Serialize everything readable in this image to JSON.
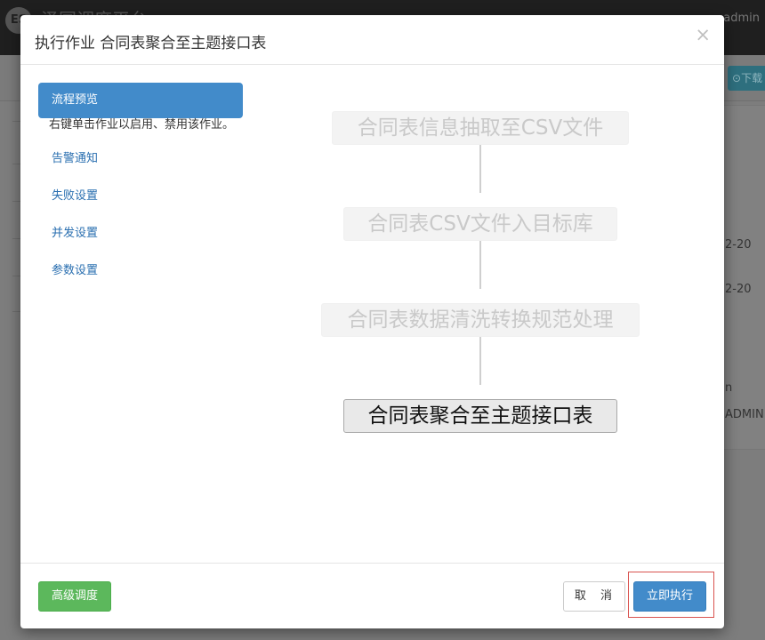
{
  "background": {
    "brand_initials": "ES",
    "brand": "泽国调度平台",
    "user": "admin",
    "page_title_char": "",
    "download_button": "下载",
    "right_column": [
      "2-20",
      "2-20",
      "n",
      "ADMIN"
    ]
  },
  "modal": {
    "title": "执行作业 合同表聚合至主题接口表",
    "close_symbol": "×",
    "menu": {
      "items": [
        {
          "label": "流程预览",
          "active": true
        },
        {
          "label": "告警通知"
        },
        {
          "label": "失败设置"
        },
        {
          "label": "并发设置"
        },
        {
          "label": "参数设置"
        }
      ],
      "hint": "右键单击作业以启用、禁用该作业。"
    },
    "flow": {
      "nodes": [
        {
          "label": "合同表信息抽取至CSV文件",
          "state": "disabled"
        },
        {
          "label": "合同表CSV文件入目标库",
          "state": "disabled"
        },
        {
          "label": "合同表数据清洗转换规范处理",
          "state": "disabled"
        },
        {
          "label": "合同表聚合至主题接口表",
          "state": "current"
        }
      ]
    },
    "footer": {
      "advanced_label": "高级调度",
      "cancel_label": "取 消",
      "run_label": "立即执行"
    }
  },
  "colors": {
    "primary": "#428bca",
    "success": "#5cb85c",
    "highlight_border": "#d9534f"
  }
}
